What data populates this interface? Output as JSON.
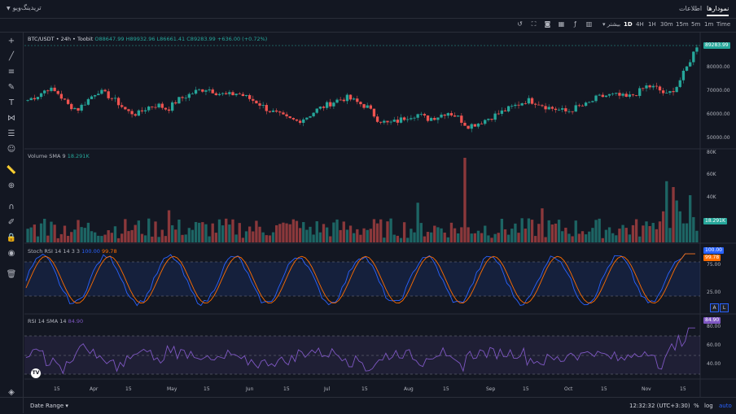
{
  "topbar": {
    "brand": "تریدینگ‌ویو",
    "tab_charts": "نمودارها",
    "tab_info": "اطلاعات"
  },
  "timeframes": [
    "Time",
    "1m",
    "5m",
    "15m",
    "30m",
    "1H",
    "4H",
    "1D"
  ],
  "active_timeframe": "1D",
  "more_label": "بیشتر",
  "symbol_line": {
    "symbol": "BTC/USDT • 24h • Toobit",
    "open": "O88647.99",
    "high": "H89932.96",
    "low": "L86661.41",
    "close": "C89283.99",
    "change": "+636.00 (+0.72%)"
  },
  "price_axis": [
    "80000.00",
    "70000.00",
    "60000.00",
    "50000.00"
  ],
  "price_tag": "89283.99",
  "volume": {
    "label": "Volume SMA 9",
    "value": "18.291K",
    "axis": [
      "80K",
      "60K",
      "40K"
    ],
    "tag": "18.291K"
  },
  "stoch": {
    "label": "Stoch RSI 14 14 3 3",
    "k": "100.00",
    "d": "99.78",
    "axis": [
      "75.00",
      "25.00"
    ],
    "tag_k": "100.00",
    "tag_d": "99.78"
  },
  "rsi": {
    "label": "RSI 14 SMA 14",
    "value": "84.90",
    "axis": [
      "80.00",
      "60.00",
      "40.00"
    ],
    "tag": "84.90"
  },
  "time_axis": [
    "15",
    "Apr",
    "15",
    "May",
    "15",
    "Jun",
    "15",
    "Jul",
    "15",
    "Aug",
    "15",
    "Sep",
    "15",
    "Oct",
    "15",
    "Nov",
    "15"
  ],
  "bottombar": {
    "date_range": "Date Range",
    "clock": "12:32:32 (UTC+3:30)",
    "percent": "%",
    "log": "log",
    "auto": "auto"
  },
  "scale_buttons": [
    "A",
    "L"
  ],
  "colors": {
    "up": "#26a69a",
    "down": "#ef5350",
    "k_line": "#2962ff",
    "d_line": "#ff6d00",
    "rsi": "#7e57c2",
    "bg": "#131722"
  },
  "chart_data": {
    "type": "candlestick",
    "title": "BTC/USDT • 24h • Toobit",
    "y_range": [
      48000,
      92000
    ],
    "last_close": 89283.99,
    "closes_approx": [
      66000,
      68000,
      71000,
      69000,
      64000,
      62000,
      66000,
      70000,
      68000,
      65000,
      61000,
      60000,
      63000,
      64000,
      62000,
      66000,
      68000,
      70000,
      71000,
      69000,
      68000,
      69000,
      67000,
      65000,
      62000,
      60000,
      58000,
      57000,
      59000,
      62000,
      64000,
      66000,
      67000,
      65000,
      63000,
      58000,
      56000,
      57000,
      59000,
      60000,
      58000,
      59000,
      61000,
      59000,
      55000,
      56000,
      58000,
      60000,
      62000,
      64000,
      66000,
      65000,
      63000,
      62000,
      61000,
      63000,
      64000,
      67000,
      68000,
      68000,
      67000,
      69000,
      72000,
      71000,
      68000,
      72000,
      80000,
      89283.99
    ],
    "stoch_k_last": 100.0,
    "stoch_d_last": 99.78,
    "rsi_last": 84.9
  }
}
